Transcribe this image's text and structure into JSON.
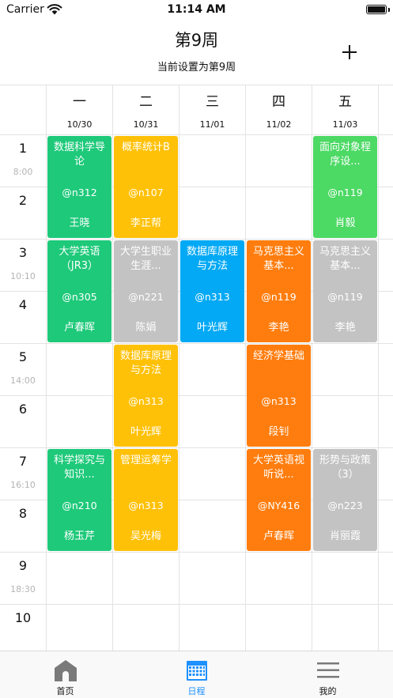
{
  "status_bar": {
    "carrier": "Carrier",
    "time": "11:14 AM"
  },
  "header": {
    "title": "第9周",
    "subtitle": "当前设置为第9周",
    "add_icon": "plus-icon"
  },
  "days": [
    {
      "name": "一",
      "date": "10/30"
    },
    {
      "name": "二",
      "date": "10/31"
    },
    {
      "name": "三",
      "date": "11/01"
    },
    {
      "name": "四",
      "date": "11/02"
    },
    {
      "name": "五",
      "date": "11/03"
    }
  ],
  "periods": [
    "1",
    "2",
    "3",
    "4",
    "5",
    "6",
    "7",
    "8",
    "9",
    "10"
  ],
  "period_times": [
    {
      "after_period": 1,
      "time": "8:00"
    },
    {
      "after_period": 3,
      "time": "10:10"
    },
    {
      "after_period": 5,
      "time": "14:00"
    },
    {
      "after_period": 7,
      "time": "16:10"
    },
    {
      "after_period": 9,
      "time": "18:30"
    }
  ],
  "colors": {
    "green": "#1ec97a",
    "yellow": "#ffc107",
    "blue": "#03a9f4",
    "orange": "#ff7d0e",
    "gray": "#c3c3c3",
    "light_green": "#4cd964",
    "tab_active": "#1e90ff",
    "tab_inactive": "#7a7a7a"
  },
  "courses": [
    {
      "day": 1,
      "start": 1,
      "span": 2,
      "name": "数据科学导论",
      "room": "@n312",
      "teacher": "王晓",
      "color": "#1ec97a"
    },
    {
      "day": 2,
      "start": 1,
      "span": 2,
      "name": "概率统计B",
      "room": "@n107",
      "teacher": "李正帮",
      "color": "#ffc107"
    },
    {
      "day": 5,
      "start": 1,
      "span": 2,
      "name": "面向对象程序设...",
      "room": "@n119",
      "teacher": "肖毅",
      "color": "#4cd964"
    },
    {
      "day": 1,
      "start": 3,
      "span": 2,
      "name": "大学英语（JR3）",
      "room": "@n305",
      "teacher": "卢春晖",
      "color": "#1ec97a"
    },
    {
      "day": 2,
      "start": 3,
      "span": 2,
      "name": "大学生职业生涯...",
      "room": "@n221",
      "teacher": "陈娟",
      "color": "#c3c3c3"
    },
    {
      "day": 3,
      "start": 3,
      "span": 2,
      "name": "数据库原理与方法",
      "room": "@n313",
      "teacher": "叶光辉",
      "color": "#03a9f4"
    },
    {
      "day": 4,
      "start": 3,
      "span": 2,
      "name": "马克思主义基本...",
      "room": "@n119",
      "teacher": "李艳",
      "color": "#ff7d0e"
    },
    {
      "day": 5,
      "start": 3,
      "span": 2,
      "name": "马克思主义基本...",
      "room": "@n119",
      "teacher": "李艳",
      "color": "#c3c3c3"
    },
    {
      "day": 2,
      "start": 5,
      "span": 2,
      "name": "数据库原理与方法",
      "room": "@n313",
      "teacher": "叶光辉",
      "color": "#ffc107"
    },
    {
      "day": 4,
      "start": 5,
      "span": 2,
      "name": "经济学基础",
      "room": "@n313",
      "teacher": "段钊",
      "color": "#ff7d0e"
    },
    {
      "day": 1,
      "start": 7,
      "span": 2,
      "name": "科学探究与知识...",
      "room": "@n210",
      "teacher": "杨玉芹",
      "color": "#1ec97a"
    },
    {
      "day": 2,
      "start": 7,
      "span": 2,
      "name": "管理运筹学",
      "room": "@n313",
      "teacher": "吴光梅",
      "color": "#ffc107"
    },
    {
      "day": 4,
      "start": 7,
      "span": 2,
      "name": "大学英语视听说...",
      "room": "@NY416",
      "teacher": "卢春晖",
      "color": "#ff7d0e"
    },
    {
      "day": 5,
      "start": 7,
      "span": 2,
      "name": "形势与政策（3）",
      "room": "@n223",
      "teacher": "肖丽霞",
      "color": "#c3c3c3"
    }
  ],
  "tabs": [
    {
      "label": "首页",
      "icon": "home-icon",
      "active": false
    },
    {
      "label": "日程",
      "icon": "calendar-icon",
      "active": true
    },
    {
      "label": "我的",
      "icon": "menu-icon",
      "active": false
    }
  ]
}
